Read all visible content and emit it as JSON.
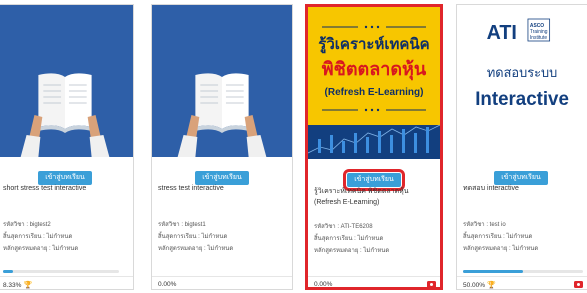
{
  "cards": [
    {
      "enroll_label": "เข้าสู่บทเรียน",
      "title": "short stress test interactive",
      "code_label": "รหัสวิชา : bigtest2",
      "end_label": "สิ้นสุดการเรียน : ไม่กำหนด",
      "deadline_label": "หลักสูตรหมดอายุ : ไม่กำหนด",
      "progress_text": "8.33%",
      "progress": 0.0833,
      "trophy": true,
      "camera": false
    },
    {
      "enroll_label": "เข้าสู่บทเรียน",
      "title": "stress test interactive",
      "code_label": "รหัสวิชา : bigtest1",
      "end_label": "สิ้นสุดการเรียน : ไม่กำหนด",
      "deadline_label": "หลักสูตรหมดอายุ : ไม่กำหนด",
      "progress_text": "0.00%",
      "progress": 0,
      "trophy": false,
      "camera": false
    },
    {
      "enroll_label": "เข้าสู่บทเรียน",
      "title": "รู้วิเคราะห์เทคนิค พิชิตตลาดหุ้น (Refresh E-Learning)",
      "code_label": "รหัสวิชา : ATI-TE6208",
      "end_label": "สิ้นสุดการเรียน : ไม่กำหนด",
      "deadline_label": "หลักสูตรหมดอายุ : ไม่กำหนด",
      "progress_text": "0.00%",
      "progress": 0,
      "trophy": false,
      "camera": true,
      "banner": {
        "line1": "รู้วิเคราะห์เทคนิค",
        "line2": "พิชิตตลาดหุ้น",
        "line3": "(Refresh E-Learning)"
      }
    },
    {
      "enroll_label": "เข้าสู่บทเรียน",
      "title": "ทดสอบ interactive",
      "code_label": "รหัสวิชา : test io",
      "end_label": "สิ้นสุดการเรียน : ไม่กำหนด",
      "deadline_label": "หลักสูตรหมดอายุ : ไม่กำหนด",
      "progress_text": "50.00%",
      "progress": 0.5,
      "trophy": true,
      "camera": true,
      "banner": {
        "logo": "ATI",
        "logo_sub1": "ASCO",
        "logo_sub2": "Training",
        "logo_sub3": "Institute",
        "line1": "ทดสอบระบบ",
        "line2": "Interactive"
      }
    }
  ],
  "colors": {
    "accent": "#3a9fd8",
    "highlight": "#e0262b",
    "banner_yellow": "#f7c600",
    "banner_blue": "#123f7f",
    "book_bg": "#2e5fa8"
  }
}
